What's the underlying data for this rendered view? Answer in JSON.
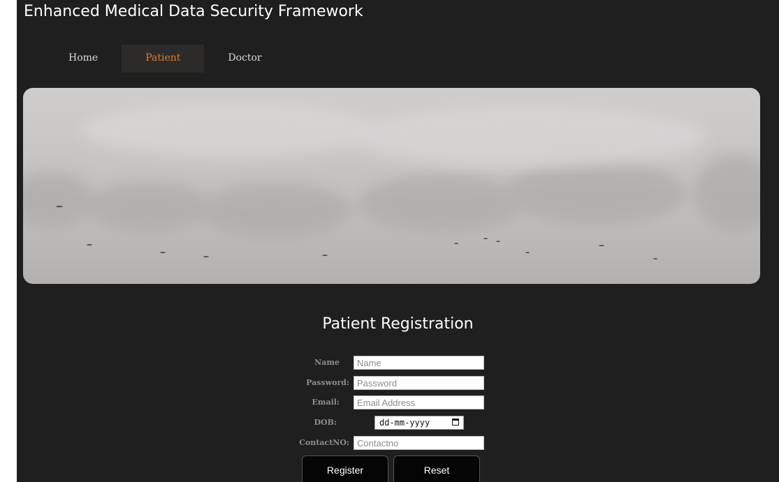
{
  "app": {
    "title": "Enhanced Medical Data Security Framework"
  },
  "nav": {
    "home": "Home",
    "patient": "Patient",
    "doctor": "Doctor",
    "active": "Patient"
  },
  "form": {
    "title": "Patient Registration",
    "name_label": "Name",
    "name_placeholder": "Name",
    "password_label": "Password:",
    "password_placeholder": "Password",
    "email_label": "Email:",
    "email_placeholder": "Email Address",
    "dob_label": "DOB:",
    "dob_value": "dd-mm-yyyy",
    "contact_label": "ContactNO:",
    "contact_placeholder": "Contactno",
    "register_label": "Register",
    "reset_label": "Reset"
  },
  "colors": {
    "page_bg": "#1f1f1f",
    "active_nav_text": "#e07a2e",
    "active_nav_bg": "#2c2b2a",
    "label_text": "#8e8e8e"
  },
  "icons": {
    "date_picker": "calendar-icon"
  }
}
